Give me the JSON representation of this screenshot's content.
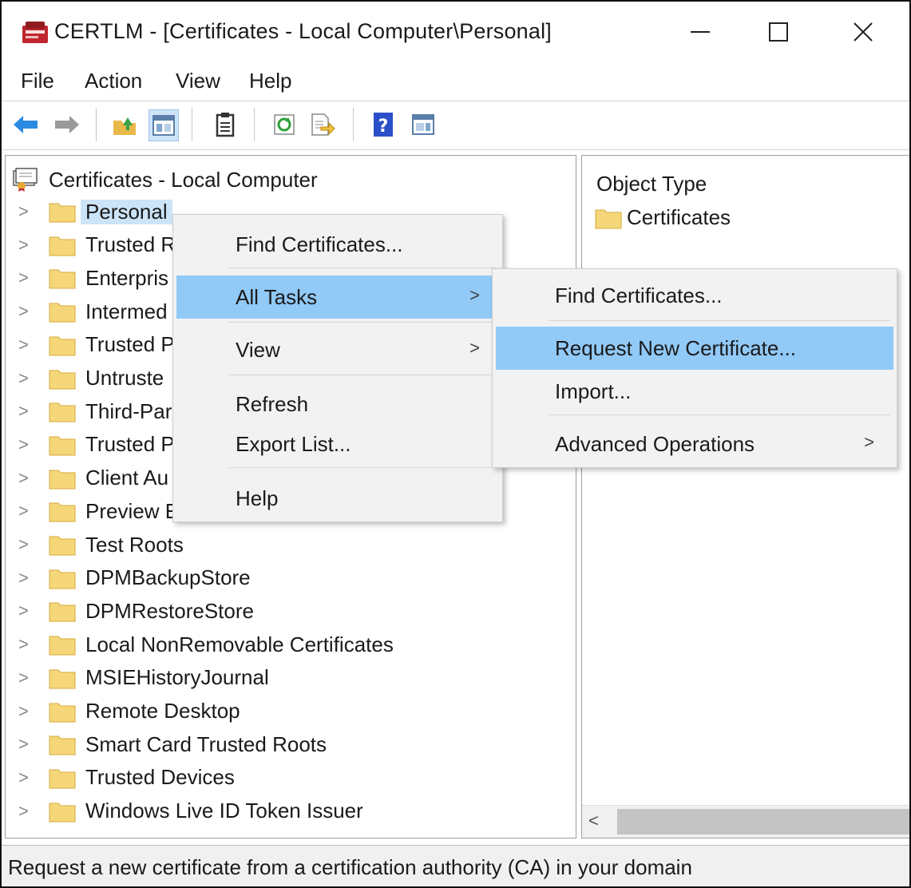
{
  "window": {
    "title": "CERTLM - [Certificates - Local Computer\\Personal]",
    "controls": {
      "minimize": "—",
      "maximize": "☐",
      "close": "✕"
    }
  },
  "menubar": [
    "File",
    "Action",
    "View",
    "Help"
  ],
  "toolbar": [
    "back-arrow-icon",
    "forward-arrow-icon",
    "up-folder-icon",
    "show-hide-tree-icon",
    "properties-icon",
    "refresh-icon",
    "export-list-icon",
    "help-icon",
    "show-action-pane-icon"
  ],
  "tree": {
    "root": "Certificates - Local Computer",
    "items": [
      "Personal",
      "Trusted R",
      "Enterpris",
      "Intermed",
      "Trusted P",
      "Untruste",
      "Third-Par",
      "Trusted P",
      "Client Au",
      "Preview E",
      "Test Roots",
      "DPMBackupStore",
      "DPMRestoreStore",
      "Local NonRemovable Certificates",
      "MSIEHistoryJournal",
      "Remote Desktop",
      "Smart Card Trusted Roots",
      "Trusted Devices",
      "Windows Live ID Token Issuer"
    ],
    "expand_glyph": ">"
  },
  "right_pane": {
    "header": "Object Type",
    "items": [
      "Certificates"
    ],
    "scroll_left": "<"
  },
  "context_menu": {
    "items": [
      "Find Certificates...",
      "All Tasks",
      "View",
      "Refresh",
      "Export List...",
      "Help"
    ],
    "submenu_arrow": ">"
  },
  "submenu": {
    "items": [
      "Find Certificates...",
      "Request New Certificate...",
      "Import...",
      "Advanced Operations"
    ]
  },
  "status": "Request a new certificate from a certification authority (CA) in your domain",
  "colors": {
    "highlight": "#91c9f7",
    "selection": "#cce4f7",
    "menu_bg": "#f2f2f2",
    "folder": "#f5d77a"
  }
}
